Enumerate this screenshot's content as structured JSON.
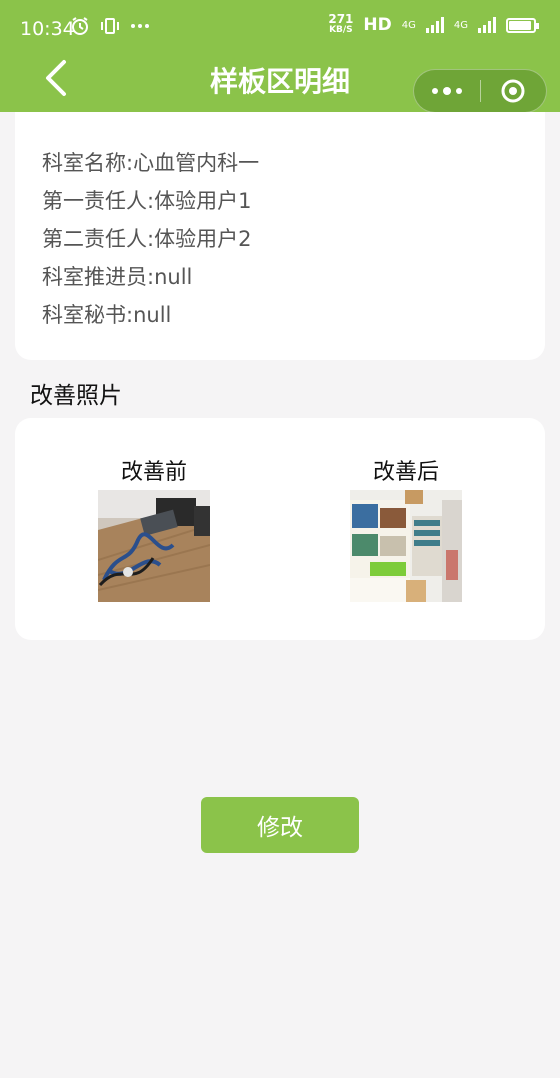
{
  "status_bar": {
    "time": "10:34",
    "speed_value": "271",
    "speed_unit": "KB/S",
    "hd": "HD",
    "net1": "4G",
    "net2": "4G"
  },
  "navbar": {
    "title": "样板区明细"
  },
  "info": {
    "dept_name": "科室名称:心血管内科一",
    "first_owner": "第一责任人:体验用户1",
    "second_owner": "第二责任人:体验用户2",
    "promoter": "科室推进员:null",
    "secretary": "科室秘书:null"
  },
  "photos": {
    "section_title": "改善照片",
    "before_label": "改善前",
    "after_label": "改善后"
  },
  "actions": {
    "edit_label": "修改"
  },
  "colors": {
    "brand_green": "#8bc34a",
    "page_bg": "#f5f4f5"
  }
}
